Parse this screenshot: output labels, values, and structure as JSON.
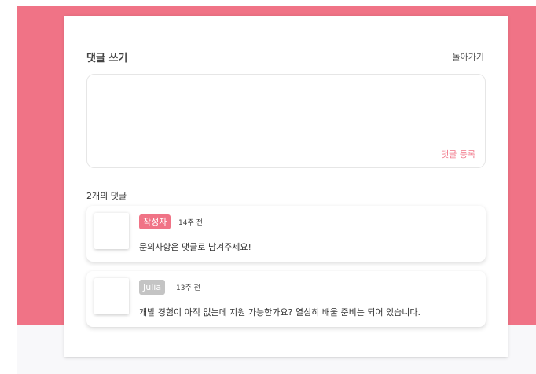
{
  "colors": {
    "accent": "#f07386",
    "author_badge": "#f07386",
    "guest_badge": "#c4c4c4"
  },
  "header": {
    "title": "댓글 쓰기",
    "back_label": "돌아가기"
  },
  "comment_form": {
    "value": "",
    "placeholder": "",
    "submit_label": "댓글 등록"
  },
  "comments": {
    "count_label": "2개의 댓글",
    "items": [
      {
        "author": "작성자",
        "is_author": true,
        "time": "14주 전",
        "text": "문의사항은 댓글로 남겨주세요!"
      },
      {
        "author": "Julia",
        "is_author": false,
        "time": "13주 전",
        "text": "개발 경험이 아직 없는데 지원 가능한가요? 열심히 배울 준비는 되어 있습니다."
      }
    ]
  }
}
